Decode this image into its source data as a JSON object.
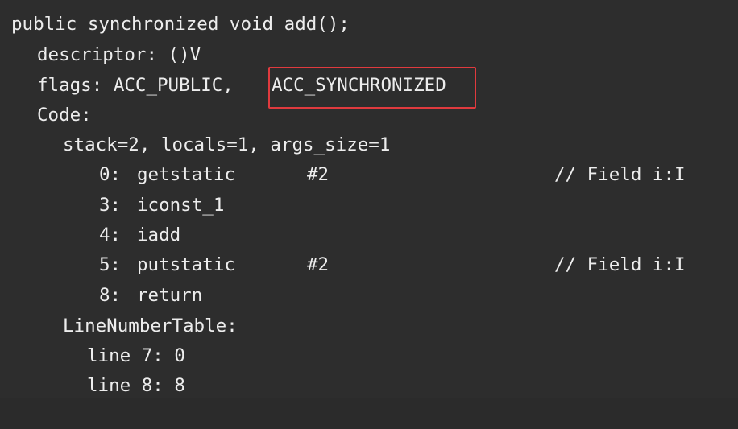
{
  "code": {
    "method_signature": "public synchronized void add();",
    "descriptor": "descriptor: ()V",
    "flags_prefix": "flags: ACC_PUBLIC, ",
    "flags_highlighted": "ACC_SYNCHRONIZED",
    "code_label": "Code:",
    "stack_info": "stack=2, locals=1, args_size=1",
    "instructions": [
      {
        "offset": "0:",
        "op": "getstatic",
        "arg": "#2",
        "comment": "// Field i:I"
      },
      {
        "offset": "3:",
        "op": "iconst_1",
        "arg": "",
        "comment": ""
      },
      {
        "offset": "4:",
        "op": "iadd",
        "arg": "",
        "comment": ""
      },
      {
        "offset": "5:",
        "op": "putstatic",
        "arg": "#2",
        "comment": "// Field i:I"
      },
      {
        "offset": "8:",
        "op": "return",
        "arg": "",
        "comment": ""
      }
    ],
    "line_number_table_label": "LineNumberTable:",
    "line_numbers": [
      "line 7: 0",
      "line 8: 8"
    ]
  },
  "colors": {
    "background": "#2d2d2d",
    "text": "#ededed",
    "highlight_border": "#e03a3e"
  }
}
